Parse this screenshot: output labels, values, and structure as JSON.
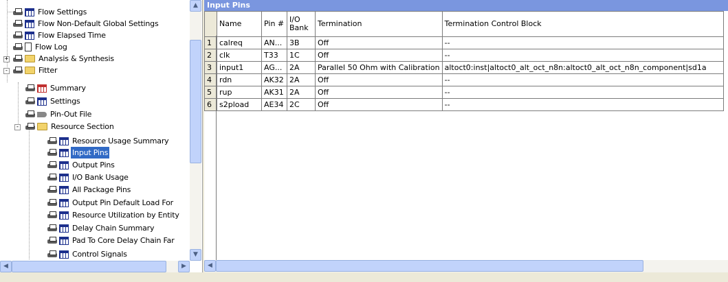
{
  "tree": {
    "items": [
      {
        "label": "Flow Settings",
        "icon": "table-icon"
      },
      {
        "label": "Flow Non-Default Global Settings",
        "icon": "table-icon"
      },
      {
        "label": "Flow Elapsed Time",
        "icon": "table-icon"
      },
      {
        "label": "Flow Log",
        "icon": "document-icon"
      },
      {
        "label": "Analysis & Synthesis",
        "icon": "folder-icon",
        "expander": "+"
      },
      {
        "label": "Fitter",
        "icon": "folder-icon",
        "expander": "-"
      },
      {
        "label": "Summary",
        "icon": "table-icon"
      },
      {
        "label": "Settings",
        "icon": "table-icon"
      },
      {
        "label": "Pin-Out File",
        "icon": "pin-icon"
      },
      {
        "label": "Resource Section",
        "icon": "folder-icon",
        "expander": "-"
      },
      {
        "label": "Resource Usage Summary",
        "icon": "table-icon"
      },
      {
        "label": "Input Pins",
        "icon": "table-icon",
        "selected": true
      },
      {
        "label": "Output Pins",
        "icon": "table-icon"
      },
      {
        "label": "I/O Bank Usage",
        "icon": "table-icon"
      },
      {
        "label": "All Package Pins",
        "icon": "table-icon"
      },
      {
        "label": "Output Pin Default Load For",
        "icon": "table-icon"
      },
      {
        "label": "Resource Utilization by Entity",
        "icon": "table-icon"
      },
      {
        "label": "Delay Chain Summary",
        "icon": "table-icon"
      },
      {
        "label": "Pad To Core Delay Chain Far",
        "icon": "table-icon"
      },
      {
        "label": "Control Signals",
        "icon": "table-icon"
      }
    ]
  },
  "report": {
    "title": "Input Pins",
    "columns": [
      {
        "label": "Name"
      },
      {
        "label": "Pin #"
      },
      {
        "label": "I/O Bank"
      },
      {
        "label": "Termination"
      },
      {
        "label": "Termination Control Block"
      }
    ],
    "rows": [
      {
        "num": "1",
        "name": "calreq",
        "pin": "AN...",
        "bank": "3B",
        "termination": "Off",
        "control": "--"
      },
      {
        "num": "2",
        "name": "clk",
        "pin": "T33",
        "bank": "1C",
        "termination": "Off",
        "control": "--"
      },
      {
        "num": "3",
        "name": "input1",
        "pin": "AG...",
        "bank": "2A",
        "termination": "Parallel 50 Ohm with Calibration",
        "control": "altoct0:inst|altoct0_alt_oct_n8n:altoct0_alt_oct_n8n_component|sd1a"
      },
      {
        "num": "4",
        "name": "rdn",
        "pin": "AK32",
        "bank": "2A",
        "termination": "Off",
        "control": "--"
      },
      {
        "num": "5",
        "name": "rup",
        "pin": "AK31",
        "bank": "2A",
        "termination": "Off",
        "control": "--"
      },
      {
        "num": "6",
        "name": "s2pload",
        "pin": "AE34",
        "bank": "2C",
        "termination": "Off",
        "control": "--"
      }
    ]
  },
  "colors": {
    "selection": "#316ac5",
    "title_bar": "#7a96df",
    "scrollbar": "#c1d3fb"
  }
}
